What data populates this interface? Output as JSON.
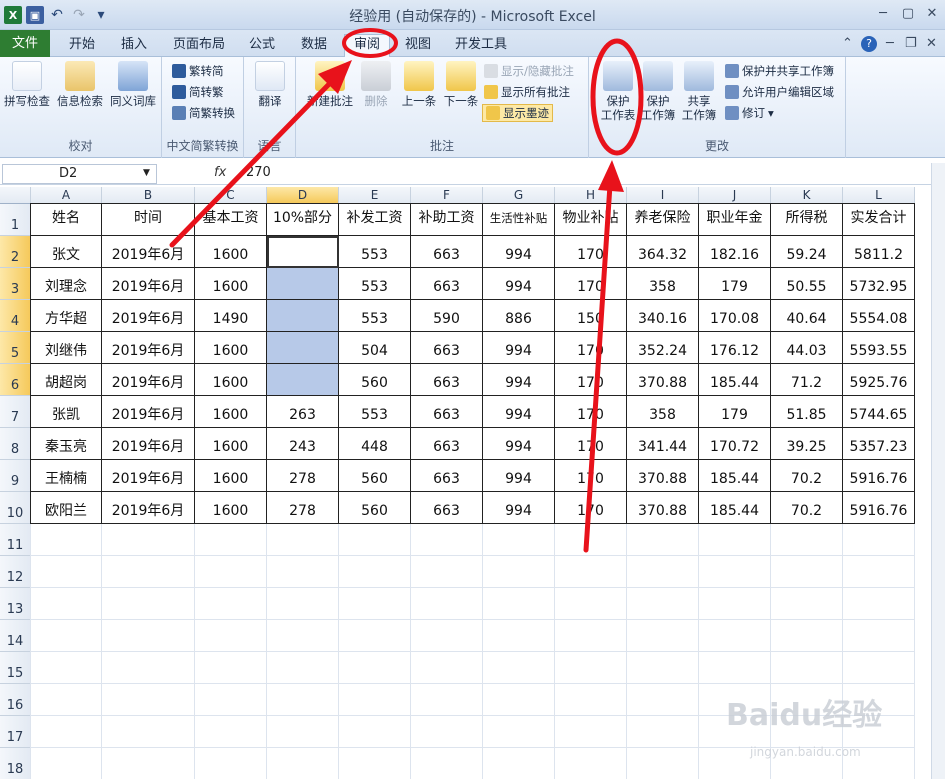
{
  "window": {
    "title": "经验用 (自动保存的) - Microsoft Excel"
  },
  "tabs": [
    {
      "label": "文件"
    },
    {
      "label": "开始"
    },
    {
      "label": "插入"
    },
    {
      "label": "页面布局"
    },
    {
      "label": "公式"
    },
    {
      "label": "数据"
    },
    {
      "label": "审阅"
    },
    {
      "label": "视图"
    },
    {
      "label": "开发工具"
    }
  ],
  "ribbon": {
    "proofing": {
      "label": "校对",
      "spell": "拼写检查",
      "research": "信息检索",
      "thesaurus": "同义词库"
    },
    "chinese": {
      "label": "中文简繁转换",
      "t2s": "繁转简",
      "s2t": "简转繁",
      "convert": "简繁转换"
    },
    "language": {
      "label": "语言",
      "translate": "翻译"
    },
    "comments": {
      "label": "批注",
      "new": "新建批注",
      "delete": "删除",
      "prev": "上一条",
      "next": "下一条",
      "showhide": "显示/隐藏批注",
      "showall": "显示所有批注",
      "ink": "显示墨迹"
    },
    "changes": {
      "label": "更改",
      "protect_sheet_1": "保护",
      "protect_sheet_2": "工作表",
      "protect_wb_1": "保护",
      "protect_wb_2": "工作簿",
      "share_1": "共享",
      "share_2": "工作簿",
      "protect_share": "保护并共享工作簿",
      "allow_edit": "允许用户编辑区域",
      "track": "修订"
    }
  },
  "formula_bar": {
    "name_box": "D2",
    "fx": "fx",
    "value": "270"
  },
  "columns": [
    "A",
    "B",
    "C",
    "D",
    "E",
    "F",
    "G",
    "H",
    "I",
    "J",
    "K",
    "L"
  ],
  "row_numbers": [
    "1",
    "2",
    "3",
    "4",
    "5",
    "6",
    "7",
    "8",
    "9",
    "10",
    "11",
    "12",
    "13",
    "14",
    "15",
    "16",
    "17",
    "18"
  ],
  "table": {
    "headers": [
      "姓名",
      "时间",
      "基本工资",
      "10%部分",
      "补发工资",
      "补助工资",
      "生活性补贴",
      "物业补贴",
      "养老保险",
      "职业年金",
      "所得税",
      "实发合计"
    ],
    "rows": [
      [
        "张文",
        "2019年6月",
        "1600",
        "",
        "553",
        "663",
        "994",
        "170",
        "364.32",
        "182.16",
        "59.24",
        "5811.2"
      ],
      [
        "刘理念",
        "2019年6月",
        "1600",
        "",
        "553",
        "663",
        "994",
        "170",
        "358",
        "179",
        "50.55",
        "5732.95"
      ],
      [
        "方华超",
        "2019年6月",
        "1490",
        "",
        "553",
        "590",
        "886",
        "150",
        "340.16",
        "170.08",
        "40.64",
        "5554.08"
      ],
      [
        "刘继伟",
        "2019年6月",
        "1600",
        "",
        "504",
        "663",
        "994",
        "170",
        "352.24",
        "176.12",
        "44.03",
        "5593.55"
      ],
      [
        "胡超岗",
        "2019年6月",
        "1600",
        "",
        "560",
        "663",
        "994",
        "170",
        "370.88",
        "185.44",
        "71.2",
        "5925.76"
      ],
      [
        "张凯",
        "2019年6月",
        "1600",
        "263",
        "553",
        "663",
        "994",
        "170",
        "358",
        "179",
        "51.85",
        "5744.65"
      ],
      [
        "秦玉亮",
        "2019年6月",
        "1600",
        "243",
        "448",
        "663",
        "994",
        "170",
        "341.44",
        "170.72",
        "39.25",
        "5357.23"
      ],
      [
        "王楠楠",
        "2019年6月",
        "1600",
        "278",
        "560",
        "663",
        "994",
        "170",
        "370.88",
        "185.44",
        "70.2",
        "5916.76"
      ],
      [
        "欧阳兰",
        "2019年6月",
        "1600",
        "278",
        "560",
        "663",
        "994",
        "170",
        "370.88",
        "185.44",
        "70.2",
        "5916.76"
      ]
    ]
  },
  "watermark": {
    "brand": "Baidu经验",
    "url": "jingyan.baidu.com"
  },
  "colors": {
    "annotation": "#e8121b",
    "selection": "#b7c9e8",
    "file_tab": "#2e7d32"
  }
}
